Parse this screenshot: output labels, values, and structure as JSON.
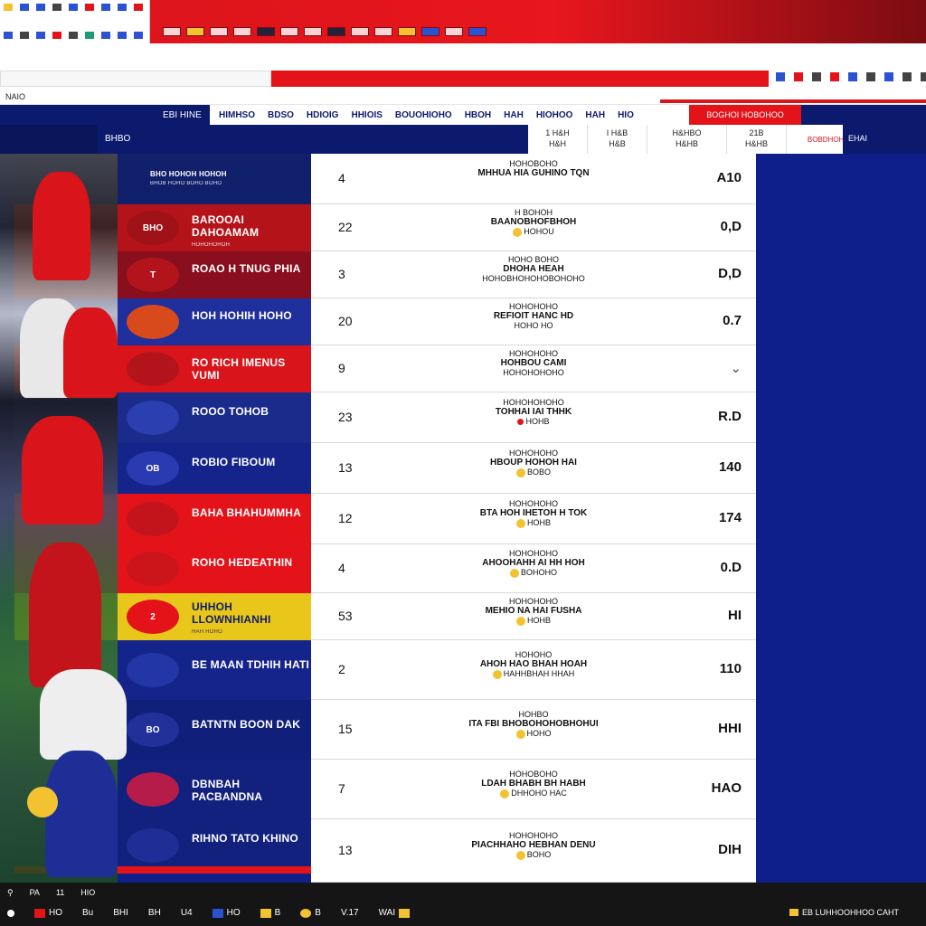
{
  "app": {
    "title": ""
  },
  "menu": {
    "label": "NAIO"
  },
  "nav": {
    "home": "EBI HINE",
    "links": [
      "HIMHSO",
      "BDSO",
      "HDIOIG",
      "HHIOIS",
      "BOUOHIOHO",
      "HBOH",
      "HAH",
      "HIOHOO",
      "HAH",
      "HIO"
    ],
    "cta": "BOGHOI HOBOHOO"
  },
  "subheader": {
    "label": "BHBO",
    "tabs": [
      {
        "l1": "1 H&H",
        "l2": "H&H"
      },
      {
        "l1": "I H&B",
        "l2": "H&B"
      },
      {
        "l1": "H&HBO",
        "l2": "H&HB"
      },
      {
        "l1": "21B",
        "l2": "H&HB"
      }
    ],
    "red_tab": "BOBDHOHOBO",
    "right": "EHAI"
  },
  "teams": [
    {
      "name": "BHO HOHOH HOHOH",
      "sub": "BHOB HOHO BOHO BOHO",
      "color": "#10206a",
      "logo": "",
      "logo_bg": "#1b2a8c"
    },
    {
      "name": "BAROOAI DAHOAMAM",
      "sub": "HOHOHOHOH",
      "color": "#b5131a",
      "logo": "BHO",
      "logo_bg": "#9e1218"
    },
    {
      "name": "ROAO H TNUG PHIA",
      "sub": "",
      "color": "#8a0f1e",
      "logo": "T",
      "logo_bg": "#b3141c"
    },
    {
      "name": "HOH HOHIH HOHO",
      "sub": "",
      "color": "#1f2f9c",
      "logo": "",
      "logo_bg": "#d84a1c"
    },
    {
      "name": "RO RICH IMENUS VUMI",
      "sub": "",
      "color": "#d9141b",
      "logo": "",
      "logo_bg": "#b3141c"
    },
    {
      "name": "ROOO TOHOB",
      "sub": "",
      "color": "#1b2b8c",
      "logo": "",
      "logo_bg": "#2b3fb0"
    },
    {
      "name": "ROBIO FIBOUM",
      "sub": "",
      "color": "#15248a",
      "logo": "OB",
      "logo_bg": "#2a3ab0"
    },
    {
      "name": "BAHA BHAHUMMHA",
      "sub": "",
      "color": "#e4131a",
      "logo": "",
      "logo_bg": "#c4141b"
    },
    {
      "name": "ROHO HEDEATHIN",
      "sub": "",
      "color": "#e4131a",
      "logo": "",
      "logo_bg": "#cc151b"
    },
    {
      "name": "UHHOH LLOWNHIANHI",
      "sub": "HAH HOHO",
      "color": "#e8c61a",
      "logo": "2",
      "logo_bg": "#e4131a"
    },
    {
      "name": "BE MAAN TDHIH HATI",
      "sub": "",
      "color": "#15248a",
      "logo": "",
      "logo_bg": "#2236a6"
    },
    {
      "name": "BATNTN BOON DAK",
      "sub": "",
      "color": "#10207a",
      "logo": "BO",
      "logo_bg": "#22309a"
    },
    {
      "name": "DBNBAH PACBANDNA",
      "sub": "",
      "color": "#12207e",
      "logo": "",
      "logo_bg": "#b51c4a"
    },
    {
      "name": "RIHNO TATO KHINO",
      "sub": "",
      "color": "#12207e",
      "logo": "",
      "logo_bg": "#1e2e96"
    }
  ],
  "matches": [
    {
      "num": "4",
      "top": "HOHOBOHO",
      "main": "MHHUA HIA GUHINO TQN",
      "sub": "",
      "score": "A10",
      "ball": ""
    },
    {
      "num": "22",
      "top": "H BOHOH",
      "main": "BAANOBHOFBHOH",
      "sub": "HOHOU",
      "score": "0,D",
      "ball": "yellow"
    },
    {
      "num": "3",
      "top": "HOHO BOHO",
      "main": "DHOHA HEAH",
      "sub": "HOHOBHOHOHOBOHOHO",
      "score": "D,D",
      "ball": ""
    },
    {
      "num": "20",
      "top": "HOHOHOHO",
      "main": "REFIOIT HANC HD",
      "sub": "HOHO HO",
      "score": "0.7",
      "ball": ""
    },
    {
      "num": "9",
      "top": "HOHOHOHO",
      "main": "HOHBOU CAMI",
      "sub": "HOHOHOHOHO",
      "score": "",
      "ball": ""
    },
    {
      "num": "23",
      "top": "HOHOHOHOHO",
      "main": "TOHHAI IAI THHK",
      "sub": "HOHB",
      "score": "R.D",
      "ball": "red"
    },
    {
      "num": "13",
      "top": "HOHOHOHO",
      "main": "HBOUP HOHOH HAI",
      "sub": "BOBO",
      "score": "140",
      "ball": "yellow"
    },
    {
      "num": "12",
      "top": "HOHOHOHO",
      "main": "BTA HOH IHETOH H TOK",
      "sub": "HOHB",
      "score": "174",
      "ball": "yellow"
    },
    {
      "num": "4",
      "top": "HOHOHOHO",
      "main": "AHOOHAHH AI HH HOH",
      "sub": "BOHOHO",
      "score": "0.D",
      "ball": "yellow"
    },
    {
      "num": "53",
      "top": "HOHOHOHO",
      "main": "MEHIO NA HAI FUSHA",
      "sub": "HOHB",
      "score": "HI",
      "ball": "yellow"
    },
    {
      "num": "2",
      "top": "HOHOHO",
      "main": "AHOH HAO BHAH HOAH",
      "sub": "HAHHBHAH HHAH",
      "score": "110",
      "ball": "yellow"
    },
    {
      "num": "15",
      "top": "HOHBO",
      "main": "ITA FBI BHOBOHOHOBHOHUI",
      "sub": "HOHO",
      "score": "HHI",
      "ball": "yellow"
    },
    {
      "num": "7",
      "top": "HOHOBOHO",
      "main": "LDAH BHABH BH HABH",
      "sub": "DHHOHO HAC",
      "score": "HAO",
      "ball": "yellow"
    },
    {
      "num": "13",
      "top": "HOHOHOHO",
      "main": "PIACHHAHO HEBHAN DENU",
      "sub": "BOHO",
      "score": "DIH",
      "ball": "yellow"
    }
  ],
  "bottom": {
    "row1": [
      "PA",
      "11",
      "HIO"
    ],
    "row2": [
      "HO",
      "Bu",
      "BHI",
      "BH",
      "U4",
      "HO",
      "B",
      "B",
      "V.17",
      "WAI"
    ],
    "right": "EB LUHHOOHHOO CAHT"
  }
}
